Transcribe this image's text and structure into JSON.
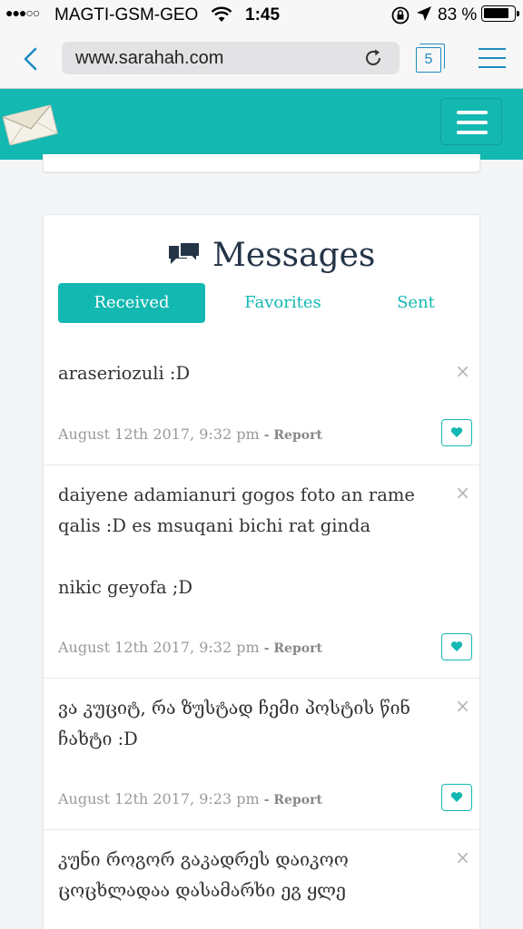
{
  "status_bar": {
    "signal": "●●●○○",
    "carrier": "MAGTI-GSM-GEO",
    "time": "1:45",
    "battery_pct": "83 %",
    "battery_level": 0.83
  },
  "browser": {
    "url": "www.sarahah.com",
    "tab_count": "5"
  },
  "messages": {
    "title": "Messages",
    "tabs": [
      {
        "label": "Received",
        "active": true
      },
      {
        "label": "Favorites",
        "active": false
      },
      {
        "label": "Sent",
        "active": false
      }
    ],
    "close_glyph": "×",
    "report_label": "- Report",
    "items": [
      {
        "text": "araseriozuli :D",
        "date": "August 12th 2017, 9:32 pm"
      },
      {
        "text": "daiyene adamianuri gogos foto an rame qalis :D es msuqani bichi rat ginda\n\nnikic geyofa ;D",
        "date": "August 12th 2017, 9:32 pm"
      },
      {
        "text": "ვა კუციტ, რა ზუსტად ჩემი პოსტის წინ ჩახტი :D",
        "date": "August 12th 2017, 9:23 pm"
      },
      {
        "text": "კუნი როგორ გაკადრეს დაიკოო ცოცხლადაა დასამარხი ეგ ყლე",
        "date": ""
      }
    ]
  },
  "colors": {
    "brand_teal": "#13b8b1",
    "title_navy": "#243447",
    "safari_blue": "#1d8bc0"
  }
}
